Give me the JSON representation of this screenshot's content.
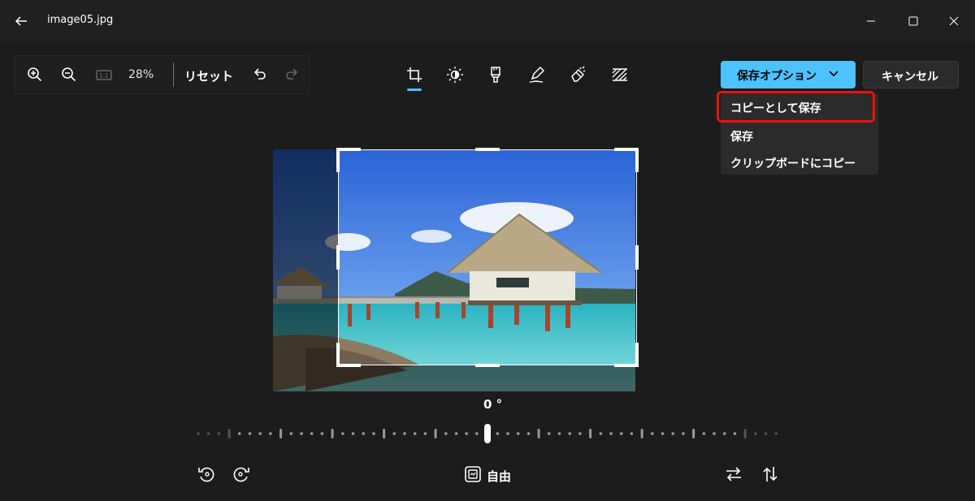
{
  "window": {
    "title": "image05.jpg"
  },
  "toolbar": {
    "zoom_value": "28%",
    "reset_label": "リセット",
    "ratio_label": "1:1"
  },
  "actions": {
    "save_options_label": "保存オプション",
    "cancel_label": "キャンセル"
  },
  "save_menu": {
    "items": [
      {
        "label": "コピーとして保存",
        "highlighted": true
      },
      {
        "label": "保存"
      },
      {
        "label": "クリップボードにコピー"
      }
    ]
  },
  "crop": {
    "angle_label": "0 °",
    "aspect_label": "自由"
  },
  "colors": {
    "accent": "#4cc2ff",
    "highlight_border": "#e8140e",
    "background": "#1c1c1c"
  }
}
